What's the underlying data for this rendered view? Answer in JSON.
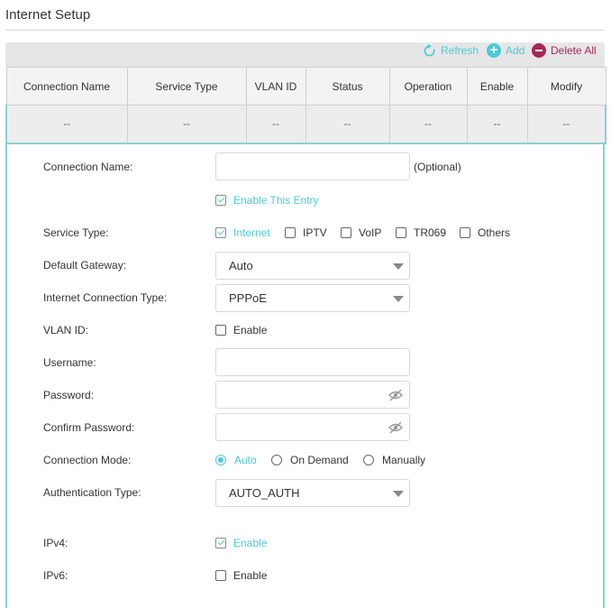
{
  "page": {
    "title": "Internet Setup"
  },
  "toolbar": {
    "refresh": "Refresh",
    "add": "Add",
    "delete_all": "Delete All"
  },
  "table": {
    "headers": [
      "Connection Name",
      "Service Type",
      "VLAN ID",
      "Status",
      "Operation",
      "Enable",
      "Modify"
    ],
    "rows": [
      [
        "--",
        "--",
        "--",
        "--",
        "--",
        "--",
        "--"
      ]
    ]
  },
  "form": {
    "connection_name": {
      "label": "Connection Name:",
      "value": "",
      "optional": "(Optional)"
    },
    "enable_entry": {
      "label": "Enable This Entry",
      "checked": true
    },
    "service_type": {
      "label": "Service Type:",
      "options": [
        {
          "label": "Internet",
          "checked": true
        },
        {
          "label": "IPTV",
          "checked": false
        },
        {
          "label": "VoIP",
          "checked": false
        },
        {
          "label": "TR069",
          "checked": false
        },
        {
          "label": "Others",
          "checked": false
        }
      ]
    },
    "default_gateway": {
      "label": "Default Gateway:",
      "value": "Auto"
    },
    "connection_type": {
      "label": "Internet Connection Type:",
      "value": "PPPoE"
    },
    "vlan_id": {
      "label": "VLAN ID:",
      "enable_label": "Enable",
      "checked": false
    },
    "username": {
      "label": "Username:",
      "value": ""
    },
    "password": {
      "label": "Password:",
      "value": ""
    },
    "confirm_password": {
      "label": "Confirm Password:",
      "value": ""
    },
    "connection_mode": {
      "label": "Connection Mode:",
      "options": [
        {
          "label": "Auto",
          "selected": true
        },
        {
          "label": "On Demand",
          "selected": false
        },
        {
          "label": "Manually",
          "selected": false
        }
      ]
    },
    "auth_type": {
      "label": "Authentication Type:",
      "value": "AUTO_AUTH"
    },
    "ipv4": {
      "label": "IPv4:",
      "enable_label": "Enable",
      "checked": true
    },
    "ipv6": {
      "label": "IPv6:",
      "enable_label": "Enable",
      "checked": false
    }
  },
  "colors": {
    "accent": "#4acbd6",
    "danger": "#a52759",
    "grid_border": "#8fcfd6"
  },
  "icons": {
    "refresh": "refresh-icon",
    "add": "plus-circle-icon",
    "delete": "minus-circle-icon",
    "eye": "eye-off-icon",
    "caret": "chevron-down-icon"
  }
}
